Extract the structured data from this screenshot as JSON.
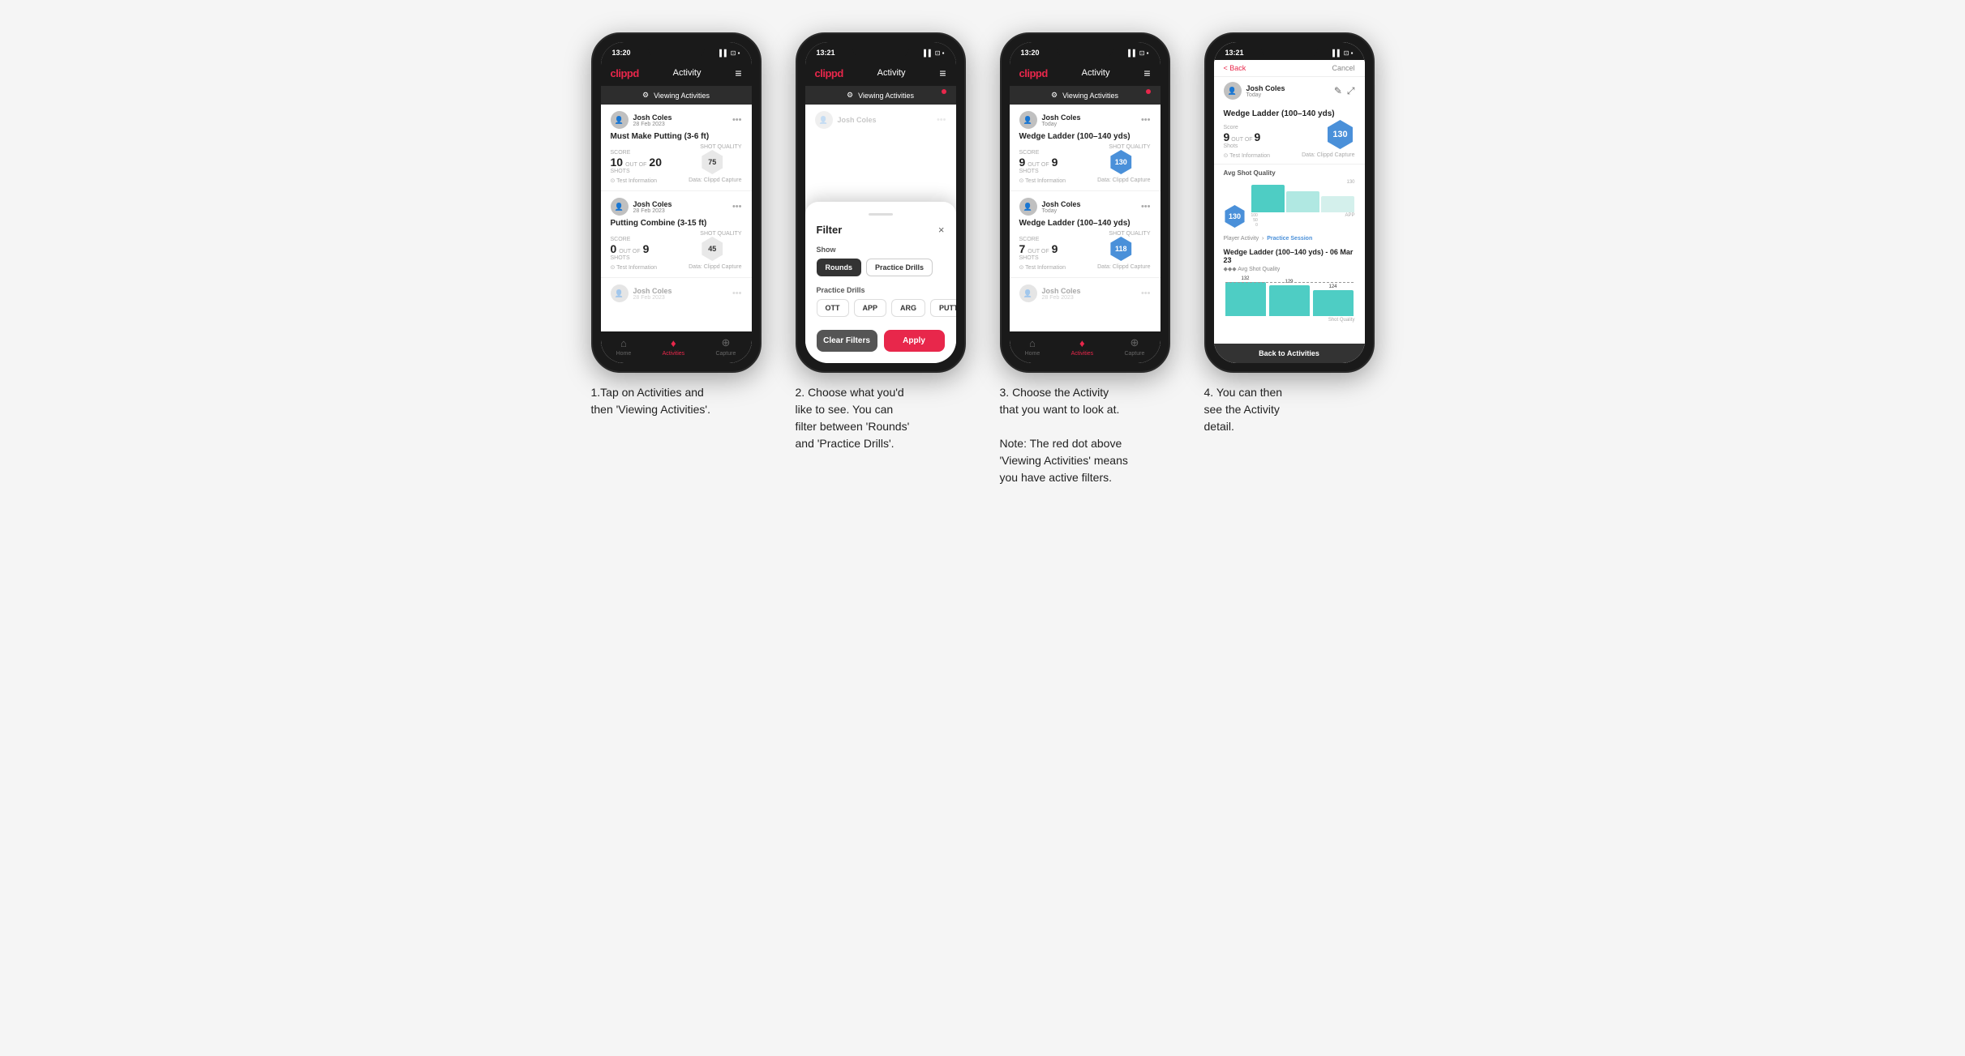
{
  "phones": [
    {
      "id": "phone1",
      "statusBar": {
        "time": "13:20",
        "icons": "▌▌ ⊡ ⬛"
      },
      "header": {
        "logo": "clippd",
        "title": "Activity",
        "menu": "≡"
      },
      "viewingActivities": "Viewing Activities",
      "redDot": true,
      "cards": [
        {
          "userName": "Josh Coles",
          "userDate": "28 Feb 2023",
          "title": "Must Make Putting (3-6 ft)",
          "scoreLabel": "Score",
          "shotsLabel": "Shots",
          "shotQualityLabel": "Shot Quality",
          "score": "10",
          "outOf": "OUT OF",
          "shots": "20",
          "shotQuality": "75",
          "shotQualityColor": "gray",
          "footer1": "⊙ Test Information",
          "footer2": "Data: Clippd Capture"
        },
        {
          "userName": "Josh Coles",
          "userDate": "28 Feb 2023",
          "title": "Putting Combine (3-15 ft)",
          "scoreLabel": "Score",
          "shotsLabel": "Shots",
          "shotQualityLabel": "Shot Quality",
          "score": "0",
          "outOf": "OUT OF",
          "shots": "9",
          "shotQuality": "45",
          "shotQualityColor": "gray",
          "footer1": "⊙ Test Information",
          "footer2": "Data: Clippd Capture"
        },
        {
          "userName": "Josh Coles",
          "userDate": "28 Feb 2023",
          "title": "",
          "partial": true
        }
      ],
      "nav": [
        {
          "icon": "⌂",
          "label": "Home",
          "active": false
        },
        {
          "icon": "♦",
          "label": "Activities",
          "active": true
        },
        {
          "icon": "⊕",
          "label": "Capture",
          "active": false
        }
      ]
    },
    {
      "id": "phone2",
      "statusBar": {
        "time": "13:21",
        "icons": "▌▌ ⊡ ⬛"
      },
      "header": {
        "logo": "clippd",
        "title": "Activity",
        "menu": "≡"
      },
      "viewingActivities": "Viewing Activities",
      "redDot": true,
      "blurredCard": {
        "userName": "Josh Coles",
        "userDate": ""
      },
      "filter": {
        "title": "Filter",
        "closeIcon": "×",
        "showLabel": "Show",
        "buttons": [
          {
            "label": "Rounds",
            "active": false
          },
          {
            "label": "Practice Drills",
            "active": true
          }
        ],
        "practiceDrillsLabel": "Practice Drills",
        "drillButtons": [
          {
            "label": "OTT",
            "active": false
          },
          {
            "label": "APP",
            "active": false
          },
          {
            "label": "ARG",
            "active": false
          },
          {
            "label": "PUTT",
            "active": false
          }
        ],
        "clearFilters": "Clear Filters",
        "apply": "Apply"
      }
    },
    {
      "id": "phone3",
      "statusBar": {
        "time": "13:20",
        "icons": "▌▌ ⊡ ⬛"
      },
      "header": {
        "logo": "clippd",
        "title": "Activity",
        "menu": "≡"
      },
      "viewingActivities": "Viewing Activities",
      "redDot": true,
      "cards": [
        {
          "userName": "Josh Coles",
          "userDate": "Today",
          "title": "Wedge Ladder (100–140 yds)",
          "scoreLabel": "Score",
          "shotsLabel": "Shots",
          "shotQualityLabel": "Shot Quality",
          "score": "9",
          "outOf": "OUT OF",
          "shots": "9",
          "shotQuality": "130",
          "shotQualityColor": "blue",
          "footer1": "⊙ Test Information",
          "footer2": "Data: Clippd Capture"
        },
        {
          "userName": "Josh Coles",
          "userDate": "Today",
          "title": "Wedge Ladder (100–140 yds)",
          "scoreLabel": "Score",
          "shotsLabel": "Shots",
          "shotQualityLabel": "Shot Quality",
          "score": "7",
          "outOf": "OUT OF",
          "shots": "9",
          "shotQuality": "118",
          "shotQualityColor": "blue",
          "footer1": "⊙ Test Information",
          "footer2": "Data: Clippd Capture"
        },
        {
          "userName": "Josh Coles",
          "userDate": "28 Feb 2023",
          "title": "",
          "partial": true
        }
      ],
      "nav": [
        {
          "icon": "⌂",
          "label": "Home",
          "active": false
        },
        {
          "icon": "♦",
          "label": "Activities",
          "active": true
        },
        {
          "icon": "⊕",
          "label": "Capture",
          "active": false
        }
      ]
    },
    {
      "id": "phone4",
      "statusBar": {
        "time": "13:21",
        "icons": "▌▌ ⊡ ⬛"
      },
      "detail": {
        "backLabel": "< Back",
        "cancelLabel": "Cancel",
        "userName": "Josh Coles",
        "userDate": "Today",
        "editIcon": "✎",
        "expandIcon": "⤢",
        "cardTitle": "Wedge Ladder (100–140 yds)",
        "scoreLabel": "Score",
        "shotsLabel": "Shots",
        "score": "9",
        "outOf": "OUT OF",
        "shots": "9",
        "testInfo": "⊙ Test Information",
        "dataCapture": "Data: Clippd Capture",
        "avgShotQualityLabel": "Avg Shot Quality",
        "hexValue": "130",
        "chartLabel": "130",
        "chartAxisLabel": "APP",
        "chartYLabels": [
          "100",
          "50",
          "0"
        ],
        "playerActivityLabel": "Player Activity",
        "practiceSessionLabel": "Practice Session",
        "wedgeTitle": "Wedge Ladder (100–140 yds) - 06 Mar 23",
        "avgQualityLabel": "◆◆◆ Avg Shot Quality",
        "barValues": [
          "132",
          "129",
          "124"
        ],
        "barValueDashed": "124 ----",
        "backToActivities": "Back to Activities"
      }
    }
  ],
  "captions": [
    "1.Tap on Activities and\nthen 'Viewing Activities'.",
    "2. Choose what you'd\nlike to see. You can\nfilter between 'Rounds'\nand 'Practice Drills'.",
    "3. Choose the Activity\nthat you want to look at.\n\nNote: The red dot above\n'Viewing Activities' means\nyou have active filters.",
    "4. You can then\nsee the Activity\ndetail."
  ]
}
